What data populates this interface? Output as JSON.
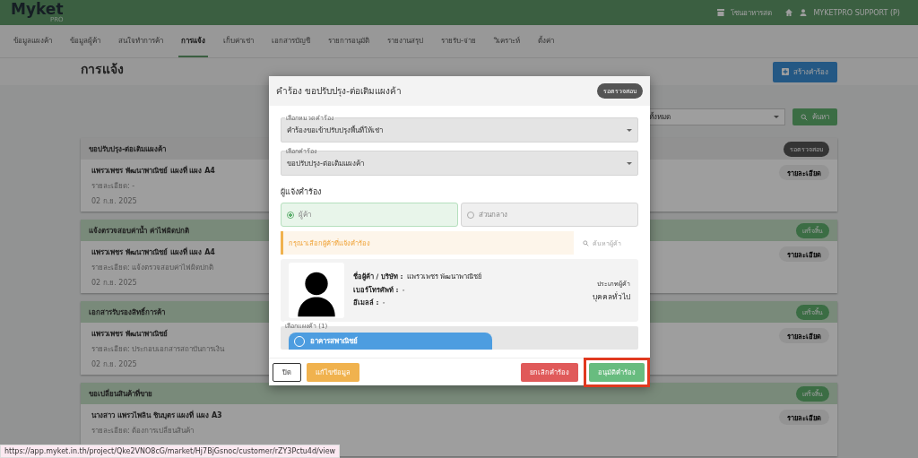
{
  "topbar": {
    "logo": "Myket",
    "logo_sub": "PRO",
    "zone": "โซนอาหารสด",
    "user": "MYKETPRO SUPPORT (P)"
  },
  "nav": [
    {
      "label": "ข้อมูลแผงค้า",
      "selected": false
    },
    {
      "label": "ข้อมูลผู้ค้า",
      "selected": false
    },
    {
      "label": "สนใจทำการค้า",
      "selected": false
    },
    {
      "label": "การแจ้ง",
      "selected": true
    },
    {
      "label": "เก็บค่าเช่า",
      "selected": false
    },
    {
      "label": "เอกสารบัญชี",
      "selected": false
    },
    {
      "label": "รายการอนุมัติ",
      "selected": false
    },
    {
      "label": "รายงานสรุป",
      "selected": false
    },
    {
      "label": "รายรับ-จ่าย",
      "selected": false
    },
    {
      "label": "วิเคราะห์",
      "selected": false
    },
    {
      "label": "ตั้งค่า",
      "selected": false
    }
  ],
  "page": {
    "title": "การแจ้ง",
    "create_button": "สร้างคำร้อง",
    "filter_value": "ทั้งหมด",
    "search_button": "ค้นหา"
  },
  "cards": [
    {
      "title": "ขอปรับปรุง-ต่อเติมแผงค้า",
      "status": "รอตรวจสอบ",
      "kind": "pending",
      "name": "แพรวเพชร พัฒนาพาณิชย์ แผงที่ แผง A4",
      "detail": "รายละเอียด: -",
      "date": "02 ก.ย. 2025",
      "button": "รายละเอียด"
    },
    {
      "title": "แจ้งตรวจสอบค่าน้ำ ค่าไฟผิดปกติ",
      "status": "เสร็จสิ้น",
      "kind": "done",
      "name": "แพรวเพชร พัฒนาพาณิชย์ แผงที่ แผง A4",
      "detail": "รายละเอียด: แจ้งตรวจสอบค่าไฟผิดปกติ",
      "date": "02 ก.ย. 2025",
      "button": "รายละเอียด"
    },
    {
      "title": "เอกสารรับรองสิทธิ์การค้า",
      "status": "เสร็จสิ้น",
      "kind": "done",
      "name": "แพรวเพชร พัฒนาพาณิชย์",
      "detail": "รายละเอียด: ประกอบเอกสารสถาบันการเงิน",
      "date": "02 ก.ย. 2025",
      "button": "รายละเอียด"
    },
    {
      "title": "ขอเปลี่ยนสินค้าที่ขาย",
      "status": "เสร็จสิ้น",
      "kind": "done",
      "name": "นางสาว แพรวไพลิน ชินบุตร แผงที่ แผง A3",
      "detail": "รายละเอียด: ต้องการเปลี่ยนสินค้า",
      "button": "รายละเอียด"
    }
  ],
  "modal": {
    "title": "คำร้อง ขอปรับปรุง-ต่อเติมแผงค้า",
    "status": "รอตรวจสอบ",
    "fields": [
      {
        "label": "เลือกหมวดคำร้อง",
        "value": "คำร้องขอเข้าปรับปรุงพื้นที่ให้เช่า"
      },
      {
        "label": "เลือกคำร้อง",
        "value": "ขอปรับปรุง-ต่อเติมแผงค้า"
      }
    ],
    "section": "ผู้แจ้งคำร้อง",
    "options": [
      {
        "label": "ผู้ค้า",
        "selected": true
      },
      {
        "label": "ส่วนกลาง",
        "selected": false
      }
    ],
    "alert": "กรุณาเลือกผู้ค้าที่แจ้งคำร้อง",
    "search_link": "ค้นหาผู้ค้า",
    "customer": {
      "lines": [
        "**ชื่อผู้ค้า / บริษัท :** แพรวเพชร พัฒนาพาณิชย์",
        "**เบอร์โทรศัพท์ :** -",
        "**อีเมลล์ :** -"
      ],
      "type_label": "ประเภทผู้ค้า",
      "type_value": "บุคคลทั่วไป"
    },
    "stall_label": "เลือกแผงค้า (1)",
    "stall": "อาคารสพาณิชย์",
    "buttons": [
      {
        "label": "ปิด",
        "kind": "outline",
        "highlighted": false
      },
      {
        "label": "แก้ไขข้อมูล",
        "kind": "warning",
        "highlighted": false
      },
      {
        "label": "ยกเลิกคำร้อง",
        "kind": "danger",
        "highlighted": false
      },
      {
        "label": "อนุมัติคำร้อง",
        "kind": "success",
        "highlighted": true
      }
    ]
  },
  "status_url": "https://app.myket.in.th/project/Qke2VNO8cG/market/Hj7BjGsnoc/customer/rZY3Pctu4d/view"
}
